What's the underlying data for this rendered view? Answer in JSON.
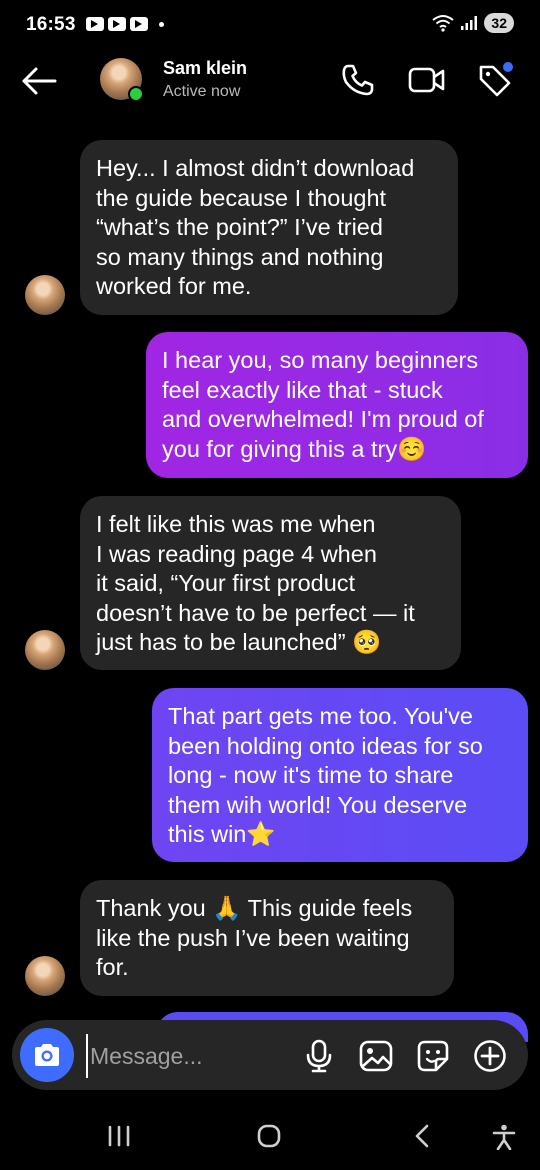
{
  "status_bar": {
    "time": "16:53",
    "battery": "32"
  },
  "header": {
    "contact_name": "Sam klein",
    "contact_status": "Active now"
  },
  "messages": [
    {
      "direction": "incoming",
      "text": "Hey... I almost didn’t download\nthe guide because I thought\n“what’s the point?” I’ve tried\nso many things and nothing\nworked for me."
    },
    {
      "direction": "outgoing",
      "text": "I hear you, so many beginners\nfeel exactly like that - stuck\nand overwhelmed! I'm proud of\nyou for giving this a try☺️"
    },
    {
      "direction": "incoming",
      "text": "I felt like this was me when\nI was reading page 4 when\nit said, “Your first product\ndoesn’t have to be perfect — it\njust has to be launched” 🥺"
    },
    {
      "direction": "outgoing",
      "text": "That part gets me too. You've\nbeen holding onto ideas for so\nlong - now it's time to share\nthem wih world! You deserve\nthis win⭐"
    },
    {
      "direction": "incoming",
      "text": "Thank you 🙏 This guide feels\nlike the push I’ve been waiting\nfor."
    }
  ],
  "composer": {
    "placeholder": "Message..."
  },
  "icons": {
    "back": "arrow-left-icon",
    "call": "phone-icon",
    "video": "video-camera-icon",
    "tag": "tag-icon",
    "camera": "camera-icon",
    "mic": "microphone-icon",
    "gallery": "image-icon",
    "sticker": "sticker-icon",
    "add": "plus-circle-icon"
  },
  "colors": {
    "incoming_bubble": "#262626",
    "outgoing_gradient_1": [
      "#a126e3",
      "#8a2ee6"
    ],
    "outgoing_gradient_2": [
      "#6f45f2",
      "#5b4cf5"
    ],
    "accent": "#3e6cff",
    "online": "#2ecc40"
  }
}
